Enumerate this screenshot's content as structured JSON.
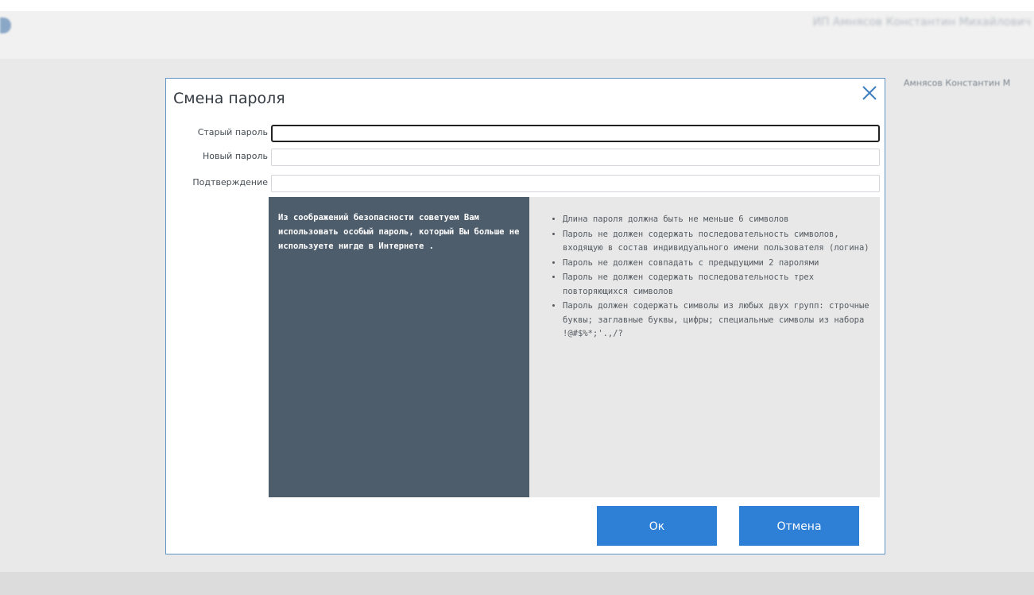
{
  "background": {
    "header_text_a": "",
    "header_text_b": "",
    "header_text_c": "",
    "user_top": "ИП Амнясов Константин Михайлович",
    "user_side": "Амнясов Константин М"
  },
  "dialog": {
    "title": "Смена пароля",
    "fields": {
      "old_password": {
        "label": "Старый пароль",
        "value": ""
      },
      "new_password": {
        "label": "Новый пароль",
        "value": ""
      },
      "confirm": {
        "label": "Подтверждение",
        "value": ""
      }
    },
    "security_note": "Из соображений безопасности советуем Вам использовать особый пароль, который Вы больше не используете нигде в Интернете .",
    "rules": [
      "Длина пароля должна быть не меньше 6 символов",
      "Пароль не должен содержать последовательность символов, входящую в состав индивидуального имени пользователя (логина)",
      "Пароль не должен совпадать с предыдущими 2 паролями",
      "Пароль не должен содержать последовательность трех повторяющихся символов",
      "Пароль должен содержать символы из любых двух групп: строчные буквы; заглавные буквы, цифры; специальные символы из набора !@#$%*;'.,/?"
    ],
    "buttons": {
      "ok": "Ок",
      "cancel": "Отмена"
    }
  },
  "colors": {
    "accent": "#2e7fd6",
    "note_panel": "#4e5d6c",
    "rules_panel": "#e8e8e8",
    "dialog_border": "#5f94c5"
  },
  "icons": {
    "close": "close-icon"
  }
}
